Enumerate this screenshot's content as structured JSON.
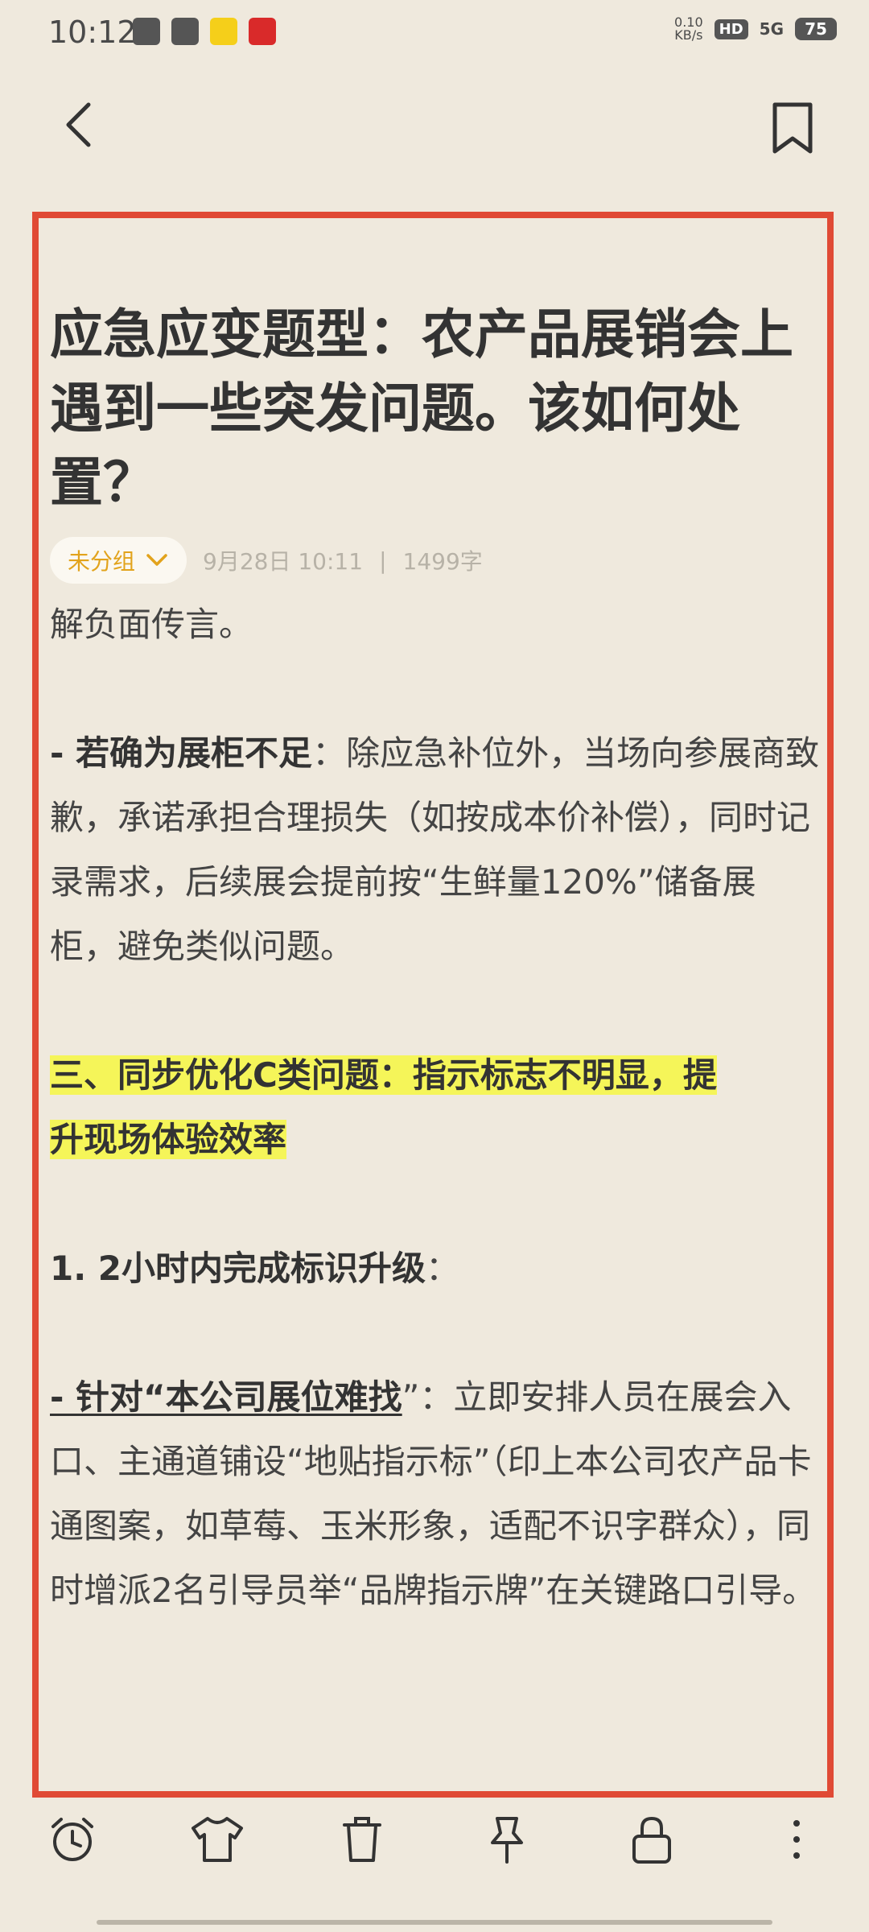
{
  "status": {
    "time": "10:12",
    "net_speed_value": "0.10",
    "net_speed_unit": "KB/s",
    "hd": "HD",
    "signal": "5G",
    "battery": "75"
  },
  "note": {
    "title": "应急应变题型：农产品展销会上遇到一些突发问题。该如何处置？",
    "group": "未分组",
    "date": "9月28日 10:11",
    "separator": "|",
    "word_count": "1499字"
  },
  "body": {
    "p1": "解负面传言。",
    "p2_bold": "- 若确为展柜不足",
    "p2_rest": "：除应急补位外，当场向参展商致歉，承诺承担合理损失（如按成本价补偿），同时记录需求，后续展会提前按“生鲜量120%”储备展柜，避免类似问题。",
    "section3_line1": "三、同步优化C类问题：指示标志不明显，提",
    "section3_line2": "升现场体验效率",
    "item1_bold": "1. 2小时内完成标识升级",
    "item1_rest": "：",
    "p5_bold": "- 针对“本公司展位难找",
    "p5_rest": "”：立即安排人员在展会入口、主通道铺设“地贴指示标”（印上本公司农产品卡通图案，如草莓、玉米形象，适配不识字群众），同时增派2名引导员举“品牌指示牌”在关键路口引导。"
  },
  "toolbar": {
    "alarm": "alarm-icon",
    "theme": "shirt-icon",
    "delete": "trash-icon",
    "pin": "pin-icon",
    "lock": "lock-icon",
    "more": "more-icon"
  }
}
